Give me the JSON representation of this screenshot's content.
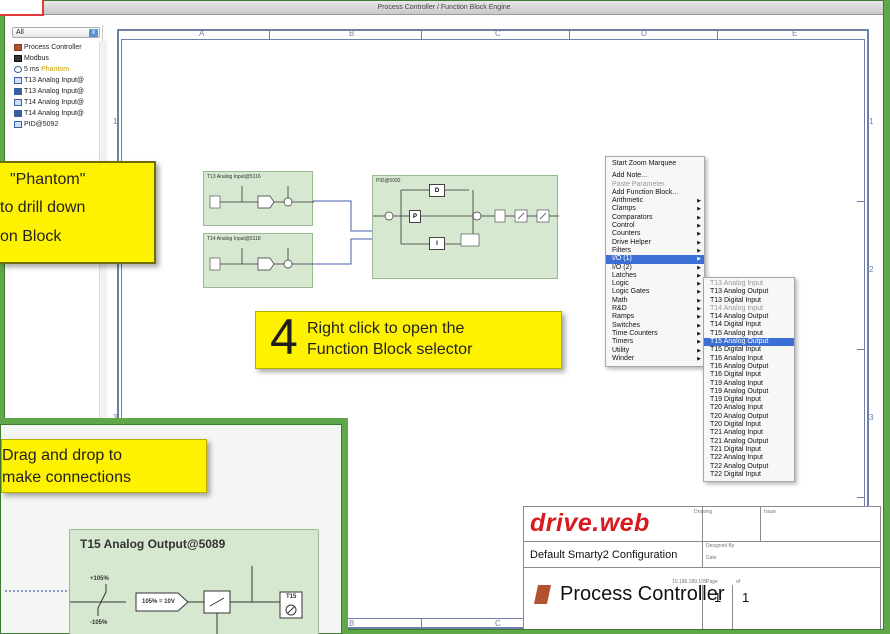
{
  "window": {
    "title": "Process Controller / Function Block Engine"
  },
  "sidebar": {
    "filter_value": "All",
    "items": [
      {
        "label": "Process Controller",
        "icon": "process-icon"
      },
      {
        "label": "Modbus",
        "icon": "modbus-icon"
      },
      {
        "label": "5 ms",
        "badge": "Phantom",
        "icon": "clock-icon"
      },
      {
        "label": "T13 Analog Input@",
        "icon": "analog-input-icon"
      },
      {
        "label": "T13 Analog Input@",
        "icon": "analog-input-icon"
      },
      {
        "label": "T14 Analog Input@",
        "icon": "analog-input-icon"
      },
      {
        "label": "T14 Analog Input@",
        "icon": "analog-input-icon"
      },
      {
        "label": "PID@5092",
        "icon": "pid-icon"
      }
    ]
  },
  "sheet": {
    "columns": [
      "A",
      "B",
      "C",
      "D",
      "E"
    ],
    "rows": [
      "1",
      "2",
      "3"
    ]
  },
  "blocks": {
    "t13": "T13 Analog Input@5116",
    "t14": "T14 Analog Input@5118",
    "pid": "PID@5092",
    "pid_d": "D",
    "pid_p": "P",
    "pid_i": "I"
  },
  "context_menu": {
    "items": [
      {
        "label": "Start Zoom Marquee"
      },
      {
        "label": "Add Note...",
        "gap": true
      },
      {
        "label": "Paste Parameter",
        "disabled": true
      },
      {
        "label": "Add Function Block..."
      },
      {
        "label": "Arithmetic",
        "submenu": true
      },
      {
        "label": "Clamps",
        "submenu": true
      },
      {
        "label": "Comparators",
        "submenu": true
      },
      {
        "label": "Control",
        "submenu": true
      },
      {
        "label": "Counters",
        "submenu": true
      },
      {
        "label": "Drive Helper",
        "submenu": true
      },
      {
        "label": "Filters",
        "submenu": true
      },
      {
        "label": "I/O (1)",
        "submenu": true,
        "selected": true
      },
      {
        "label": "I/O (2)",
        "submenu": true
      },
      {
        "label": "Latches",
        "submenu": true
      },
      {
        "label": "Logic",
        "submenu": true
      },
      {
        "label": "Logic Gates",
        "submenu": true
      },
      {
        "label": "Math",
        "submenu": true
      },
      {
        "label": "R&D",
        "submenu": true
      },
      {
        "label": "Ramps",
        "submenu": true
      },
      {
        "label": "Switches",
        "submenu": true
      },
      {
        "label": "Time Counters",
        "submenu": true
      },
      {
        "label": "Timers",
        "submenu": true
      },
      {
        "label": "Utility",
        "submenu": true
      },
      {
        "label": "Winder",
        "submenu": true
      }
    ]
  },
  "submenu": {
    "items": [
      {
        "label": "T13 Analog Input",
        "disabled": true
      },
      {
        "label": "T13 Analog Output"
      },
      {
        "label": "T13 Digital Input"
      },
      {
        "label": "T14 Analog Input",
        "disabled": true
      },
      {
        "label": "T14 Analog Output"
      },
      {
        "label": "T14 Digital Input"
      },
      {
        "label": "T15 Analog Input"
      },
      {
        "label": "T15 Analog Output",
        "selected": true
      },
      {
        "label": "T15 Digital Input"
      },
      {
        "label": "T16 Analog Input"
      },
      {
        "label": "T16 Analog Output"
      },
      {
        "label": "T16 Digital Input"
      },
      {
        "label": "T19 Analog Input"
      },
      {
        "label": "T19 Analog Output"
      },
      {
        "label": "T19 Digital Input"
      },
      {
        "label": "T20 Analog Input"
      },
      {
        "label": "T20 Analog Output"
      },
      {
        "label": "T20 Digital Input"
      },
      {
        "label": "T21 Analog Input"
      },
      {
        "label": "T21 Analog Output"
      },
      {
        "label": "T21 Digital Input"
      },
      {
        "label": "T22 Analog Input"
      },
      {
        "label": "T22 Analog Output"
      },
      {
        "label": "T22 Digital Input"
      }
    ]
  },
  "callouts": {
    "phantom_lines": [
      "\"Phantom\"",
      "to drill down",
      "on Block"
    ],
    "step_number": "4",
    "right_click_lines": [
      "Right click to open the",
      "Function Block selector"
    ],
    "drag_lines": [
      "Drag and drop to",
      "make connections"
    ]
  },
  "title_block": {
    "logo": "drive.web",
    "configuration": "Default Smarty2 Configuration",
    "name": "Process Controller",
    "drawing_label": "Drawing",
    "issue_label": "Issue",
    "designed_by_label": "Designed By",
    "date_label": "Date",
    "ip": "10.186.189.105",
    "page_label": "Page",
    "of_label": "of",
    "page": "1",
    "page_total": "1"
  },
  "inset_block": {
    "title": "T15 Analog Output@5089",
    "pos_label": "+105%",
    "neg_label": "-105%",
    "scale_label": "105% = 10V",
    "terminal_label": "T15"
  },
  "colors": {
    "accent_green": "#5fa84a",
    "callout_yellow": "#fff200",
    "menu_selection": "#3b6fd4",
    "block_fill": "#d6e8cf",
    "logo_red": "#d71920"
  }
}
